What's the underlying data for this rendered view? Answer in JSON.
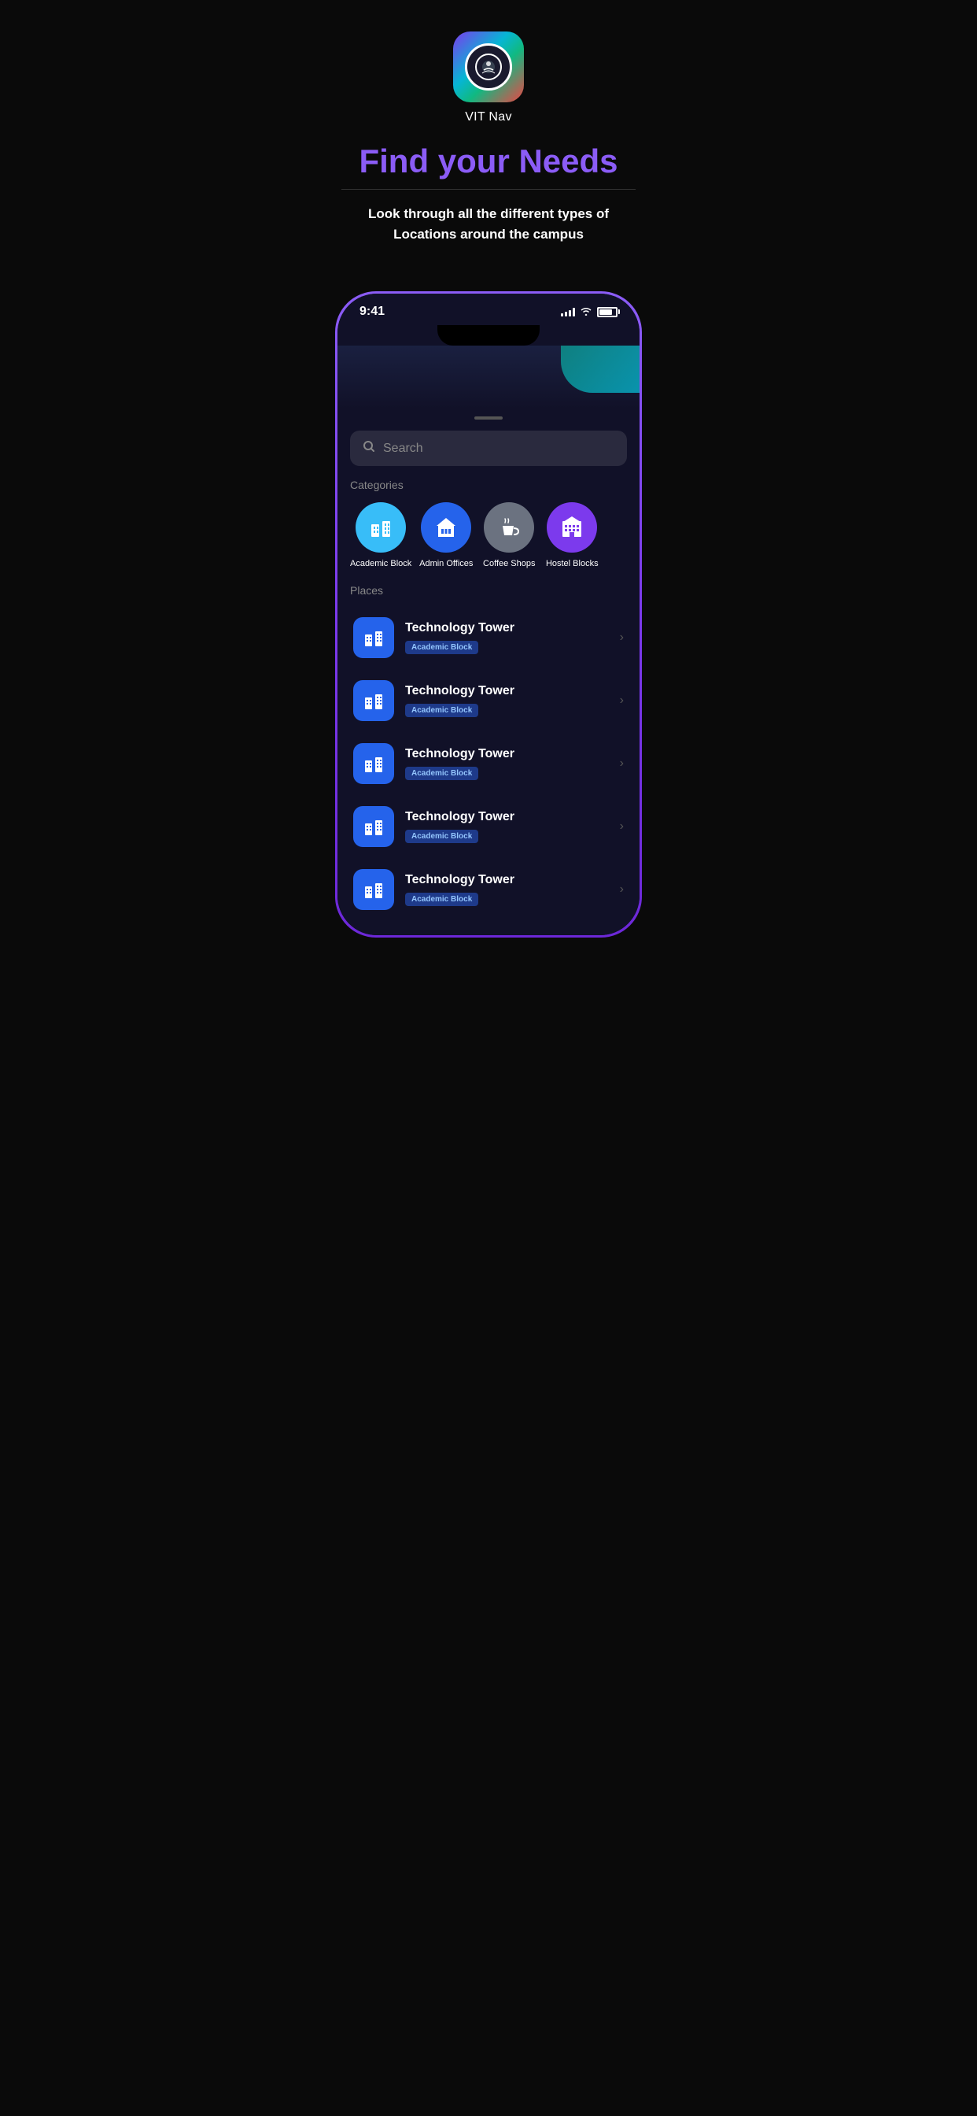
{
  "app": {
    "name": "VIT Nav"
  },
  "header": {
    "headline": "Find your Needs",
    "subtitle": "Look through all the different types of Locations around the campus"
  },
  "phone": {
    "status_bar": {
      "time": "9:41"
    },
    "drag_indicator": true,
    "search": {
      "placeholder": "Search"
    },
    "categories_label": "Categories",
    "categories": [
      {
        "id": "academic-block",
        "label": "Academic Block",
        "color": "sky-blue"
      },
      {
        "id": "admin-offices",
        "label": "Admin Offices",
        "color": "deep-blue"
      },
      {
        "id": "coffee-shops",
        "label": "Coffee Shops",
        "color": "gray"
      },
      {
        "id": "hostel-blocks",
        "label": "Hostel Blocks",
        "color": "medium-purple"
      }
    ],
    "places_label": "Places",
    "places": [
      {
        "id": "place-1",
        "name": "Technology Tower",
        "badge": "Academic Block"
      },
      {
        "id": "place-2",
        "name": "Technology Tower",
        "badge": "Academic Block"
      },
      {
        "id": "place-3",
        "name": "Technology Tower",
        "badge": "Academic Block"
      },
      {
        "id": "place-4",
        "name": "Technology Tower",
        "badge": "Academic Block"
      },
      {
        "id": "place-5",
        "name": "Technology Tower",
        "badge": "Academic Block"
      }
    ]
  }
}
